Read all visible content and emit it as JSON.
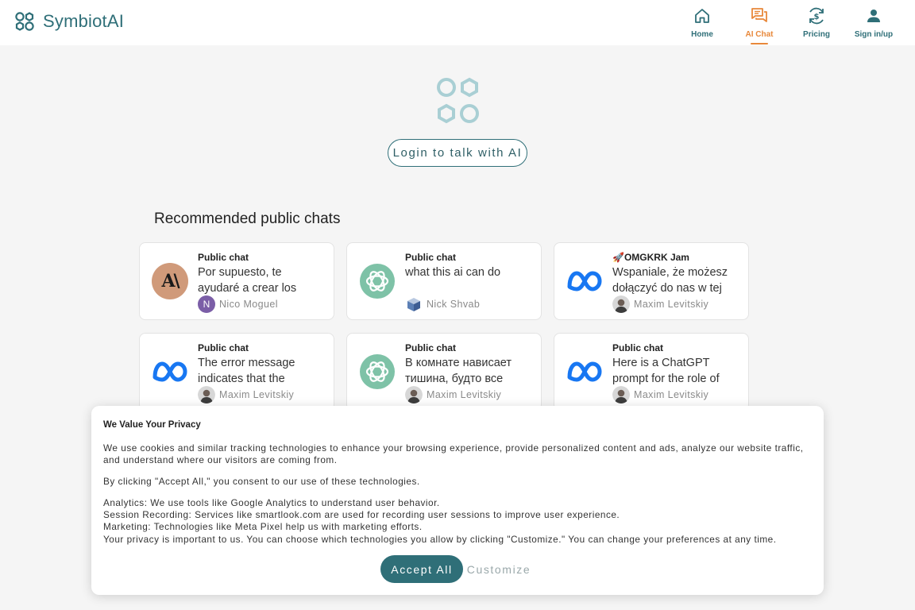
{
  "brand": {
    "name": "SymbiotAI",
    "accent": "#2f6f78",
    "active": "#e8883a"
  },
  "nav": [
    {
      "label": "Home",
      "icon": "home-icon"
    },
    {
      "label": "AI Chat",
      "icon": "chat-icon",
      "active": true
    },
    {
      "label": "Pricing",
      "icon": "pricing-icon"
    },
    {
      "label": "Sign in/up",
      "icon": "user-icon"
    }
  ],
  "hero": {
    "login_label": "Login to talk with AI"
  },
  "section": {
    "title": "Recommended public chats"
  },
  "cards": [
    {
      "title": "Public chat",
      "text": "Por supuesto, te ayudaré a crear los diagramas de",
      "user": "Nico Moguel",
      "avatar": "anthropic-icon",
      "user_avatar": "N"
    },
    {
      "title": "Public chat",
      "text": "what this ai can do",
      "user": "Nick Shvab",
      "avatar": "openai-icon"
    },
    {
      "title": "🚀OMGKRK Jam",
      "text": "Wspaniale, że możesz dołączyć do nas w tej",
      "user": "Maxim Levitskiy",
      "avatar": "meta-icon"
    },
    {
      "title": "Public chat",
      "text": "The error message indicates that the",
      "user": "Maxim Levitskiy",
      "avatar": "meta-icon"
    },
    {
      "title": "Public chat",
      "text": "В комнате нависает тишина, будто все",
      "user": "Maxim Levitskiy",
      "avatar": "openai-icon"
    },
    {
      "title": "Public chat",
      "text": "Here is a ChatGPT prompt for the role of",
      "user": "Maxim Levitskiy",
      "avatar": "meta-icon"
    }
  ],
  "cookie": {
    "title": "We Value Your Privacy",
    "p1": "We use cookies and similar tracking technologies to enhance your browsing experience, provide personalized content and ads, analyze our website traffic, and understand where our visitors are coming from.",
    "p2": "By clicking \"Accept All,\" you consent to our use of these technologies.",
    "p3_lines": [
      "Analytics: We use tools like Google Analytics to understand user behavior.",
      "Session Recording: Services like smartlook.com are used for recording user sessions to improve user experience.",
      "Marketing: Technologies like Meta Pixel help us with marketing efforts.",
      "Your privacy is important to us. You can choose which technologies you allow by clicking \"Customize.\" You can change your preferences at any time."
    ],
    "accept_label": "Accept All",
    "customize_label": "Customize"
  }
}
